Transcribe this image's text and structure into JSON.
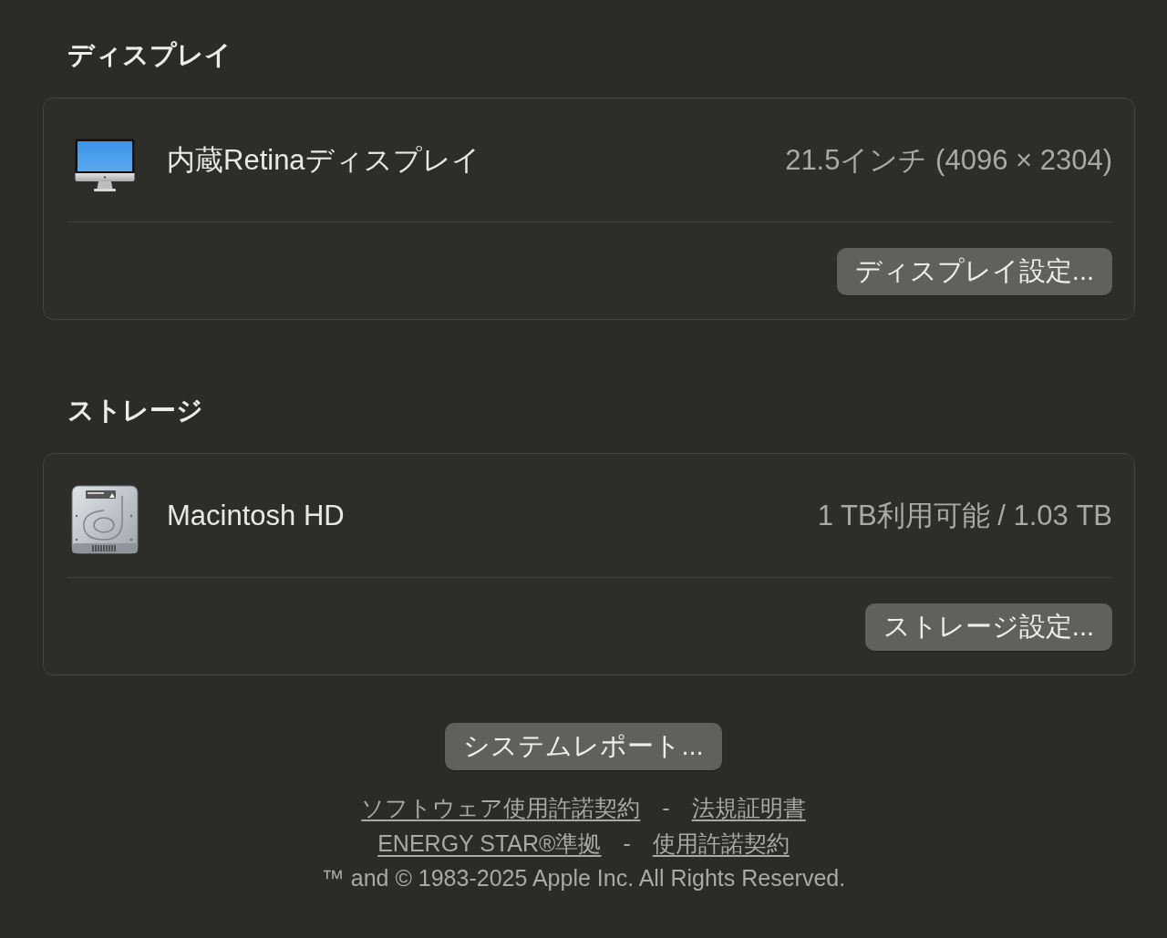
{
  "sections": [
    {
      "heading": "ディスプレイ",
      "kind": "display",
      "name": "内蔵Retinaディスプレイ",
      "detail": "21.5インチ (4096 × 2304)",
      "button": "ディスプレイ設定..."
    },
    {
      "heading": "ストレージ",
      "kind": "disk",
      "name": "Macintosh HD",
      "detail": "1 TB利用可能 / 1.03 TB",
      "button": "ストレージ設定..."
    }
  ],
  "system_report_button": "システムレポート...",
  "link_rows": [
    {
      "links": [
        "ソフトウェア使用許諾契約",
        "法規証明書"
      ],
      "separator": "-"
    },
    {
      "links": [
        "ENERGY STAR®準拠",
        "使用許諾契約"
      ],
      "separator": "-"
    }
  ],
  "copyright": "™ and © 1983-2025 Apple Inc. All Rights Reserved."
}
